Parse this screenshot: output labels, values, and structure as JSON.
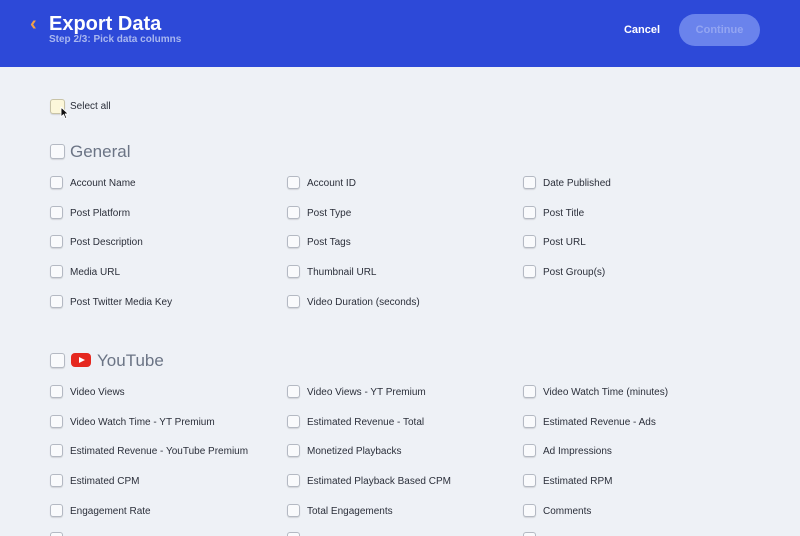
{
  "header": {
    "title": "Export Data",
    "step": "Step 2/3: Pick data columns",
    "cancel_label": "Cancel",
    "continue_label": "Continue",
    "colors": {
      "bar": "#2d49d8",
      "back_arrow": "#f0a04a"
    }
  },
  "select_all": {
    "label": "Select all",
    "checked": false
  },
  "sections": [
    {
      "title": "General",
      "icon": "",
      "items": [
        "Account Name",
        "Account ID",
        "Date Published",
        "Post Platform",
        "Post Type",
        "Post Title",
        "Post Description",
        "Post Tags",
        "Post URL",
        "Media URL",
        "Thumbnail URL",
        "Post Group(s)",
        "Post Twitter Media Key",
        "Video Duration (seconds)"
      ]
    },
    {
      "title": "YouTube",
      "icon": "youtube-logo",
      "items": [
        "Video Views",
        "Video Views - YT Premium",
        "Video Watch Time (minutes)",
        "Video Watch Time - YT Premium",
        "Estimated Revenue - Total",
        "Estimated Revenue - Ads",
        "Estimated Revenue - YouTube Premium",
        "Monetized Playbacks",
        "Ad Impressions",
        "Estimated CPM",
        "Estimated Playback Based CPM",
        "Estimated RPM",
        "Engagement Rate",
        "Total Engagements",
        "Comments"
      ]
    }
  ]
}
